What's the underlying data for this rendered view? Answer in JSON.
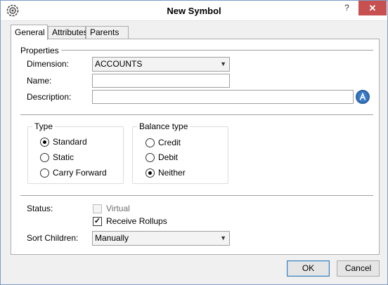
{
  "window": {
    "title": "New Symbol",
    "help_glyph": "?",
    "close_glyph": "✕",
    "app_icon": "gear-icon"
  },
  "tabs": [
    {
      "label": "General",
      "active": true
    },
    {
      "label": "Attributes",
      "active": false
    },
    {
      "label": "Parents",
      "active": false
    }
  ],
  "properties": {
    "section_label": "Properties",
    "dimension_label": "Dimension:",
    "dimension_value": "ACCOUNTS",
    "name_label": "Name:",
    "name_value": "",
    "description_label": "Description:",
    "description_value": "",
    "description_button_icon": "alias-icon"
  },
  "type_group": {
    "title": "Type",
    "options": [
      {
        "label": "Standard",
        "selected": true
      },
      {
        "label": "Static",
        "selected": false
      },
      {
        "label": "Carry Forward",
        "selected": false
      }
    ]
  },
  "balance_group": {
    "title": "Balance type",
    "options": [
      {
        "label": "Credit",
        "selected": false
      },
      {
        "label": "Debit",
        "selected": false
      },
      {
        "label": "Neither",
        "selected": true
      }
    ]
  },
  "status": {
    "label": "Status:",
    "virtual_label": "Virtual",
    "virtual_checked": false,
    "virtual_enabled": false,
    "receive_rollups_label": "Receive Rollups",
    "receive_rollups_checked": true,
    "check_glyph": "✓"
  },
  "sort_children": {
    "label": "Sort Children:",
    "value": "Manually"
  },
  "buttons": {
    "ok": "OK",
    "cancel": "Cancel"
  },
  "dropdown_glyph": "▼",
  "colors": {
    "close_button": "#c75050",
    "alias_button": "#3a7bc8"
  }
}
